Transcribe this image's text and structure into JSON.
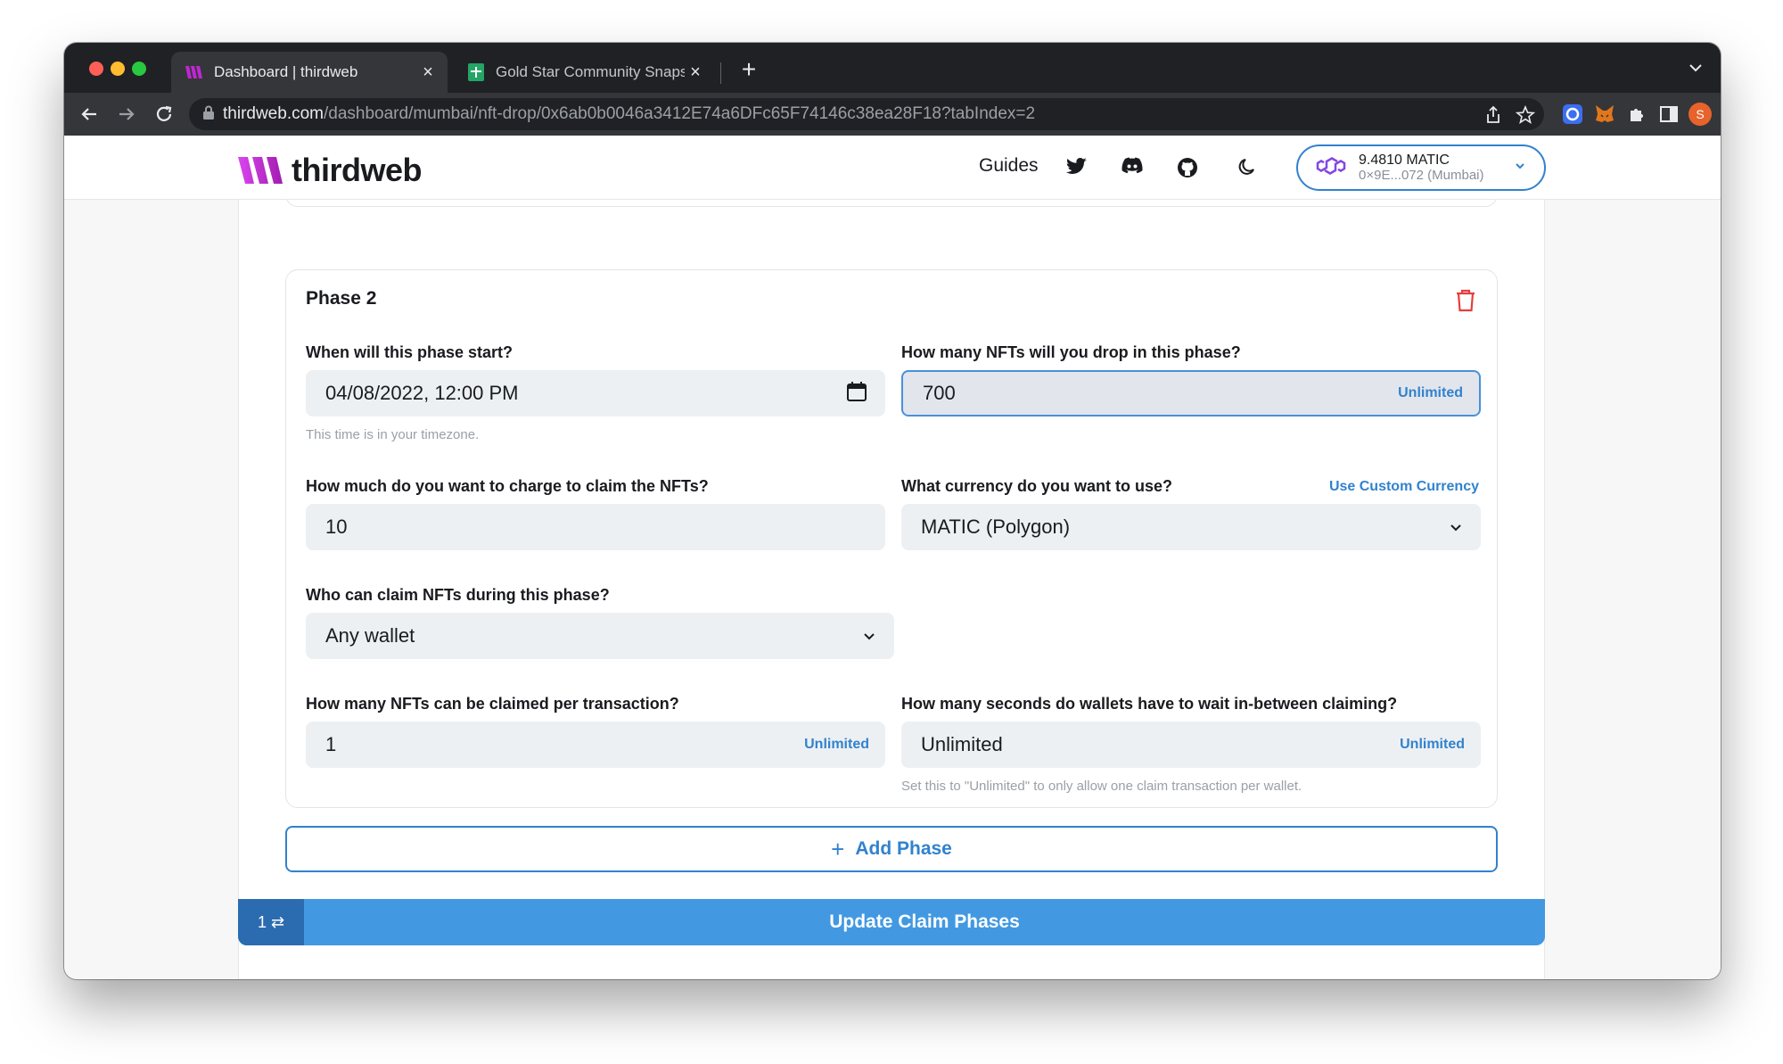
{
  "browser": {
    "tabs": [
      {
        "title": "Dashboard | thirdweb",
        "active": true
      },
      {
        "title": "Gold Star Community Snapshot",
        "active": false
      }
    ],
    "url_host": "thirdweb.com",
    "url_path": "/dashboard/mumbai/nft-drop/0x6ab0b0046a3412E74a6DFc65F74146c38ea28F18?tabIndex=2",
    "profile_initial": "S"
  },
  "header": {
    "logo_text": "thirdweb",
    "nav_guides": "Guides",
    "wallet": {
      "balance": "9.4810 MATIC",
      "address": "0×9E...072 (Mumbai)"
    }
  },
  "phase": {
    "title": "Phase 2",
    "start_label": "When will this phase start?",
    "start_value": "04/08/2022, 12:00 PM",
    "start_helper": "This time is in your timezone.",
    "drop_label": "How many NFTs will you drop in this phase?",
    "drop_value": "700",
    "drop_suffix": "Unlimited",
    "price_label": "How much do you want to charge to claim the NFTs?",
    "price_value": "10",
    "currency_label": "What currency do you want to use?",
    "currency_link": "Use Custom Currency",
    "currency_value": "MATIC (Polygon)",
    "who_label": "Who can claim NFTs during this phase?",
    "who_value": "Any wallet",
    "per_tx_label": "How many NFTs can be claimed per transaction?",
    "per_tx_value": "1",
    "per_tx_suffix": "Unlimited",
    "wait_label": "How many seconds do wallets have to wait in-between claiming?",
    "wait_value": "Unlimited",
    "wait_suffix": "Unlimited",
    "wait_helper": "Set this to \"Unlimited\" to only allow one claim transaction per wallet."
  },
  "actions": {
    "add_phase": "Add Phase",
    "add_phase_plus": "+",
    "footer_count": "1 ⇄",
    "update_label": "Update Claim Phases"
  },
  "colors": {
    "accent": "#3182ce",
    "footer": "#4299e1",
    "danger": "#e53e3e"
  }
}
